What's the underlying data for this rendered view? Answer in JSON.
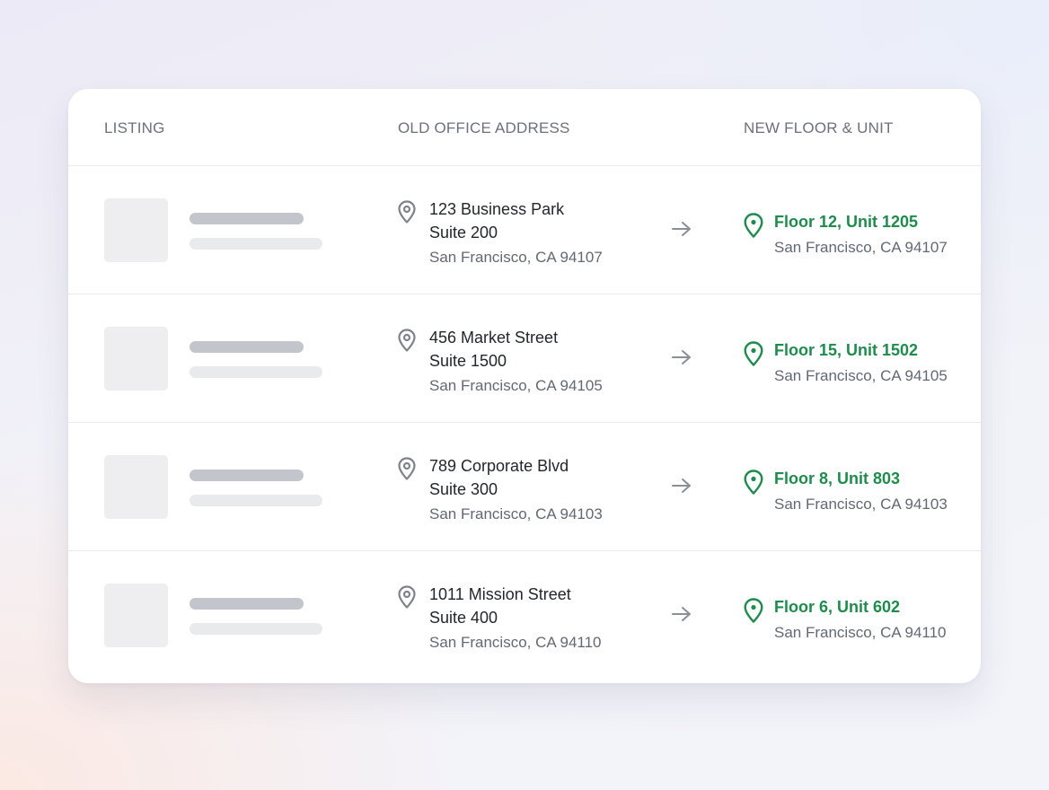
{
  "table": {
    "headers": {
      "listing": "LISTING",
      "old_address": "OLD OFFICE ADDRESS",
      "new_unit": "NEW FLOOR & UNIT"
    },
    "rows": [
      {
        "old": {
          "line1": "123 Business Park",
          "line2": "Suite 200",
          "city": "San Francisco, CA 94107"
        },
        "new": {
          "unit": "Floor 12, Unit 1205",
          "city": "San Francisco, CA 94107"
        }
      },
      {
        "old": {
          "line1": "456 Market Street",
          "line2": "Suite 1500",
          "city": "San Francisco, CA 94105"
        },
        "new": {
          "unit": "Floor 15, Unit 1502",
          "city": "San Francisco, CA 94105"
        }
      },
      {
        "old": {
          "line1": "789 Corporate Blvd",
          "line2": "Suite 300",
          "city": "San Francisco, CA 94103"
        },
        "new": {
          "unit": "Floor 8, Unit 803",
          "city": "San Francisco, CA 94103"
        }
      },
      {
        "old": {
          "line1": "1011 Mission Street",
          "line2": "Suite 400",
          "city": "San Francisco, CA 94110"
        },
        "new": {
          "unit": "Floor 6, Unit 602",
          "city": "San Francisco, CA 94110"
        }
      }
    ]
  },
  "icons": {
    "old_pin": "map-pin-icon",
    "new_pin": "map-pin-icon",
    "arrow": "arrow-right-icon"
  },
  "colors": {
    "accent_green": "#1e8c4c",
    "old_pin_gray": "#7d828c",
    "placeholder": "#eeeef0"
  }
}
